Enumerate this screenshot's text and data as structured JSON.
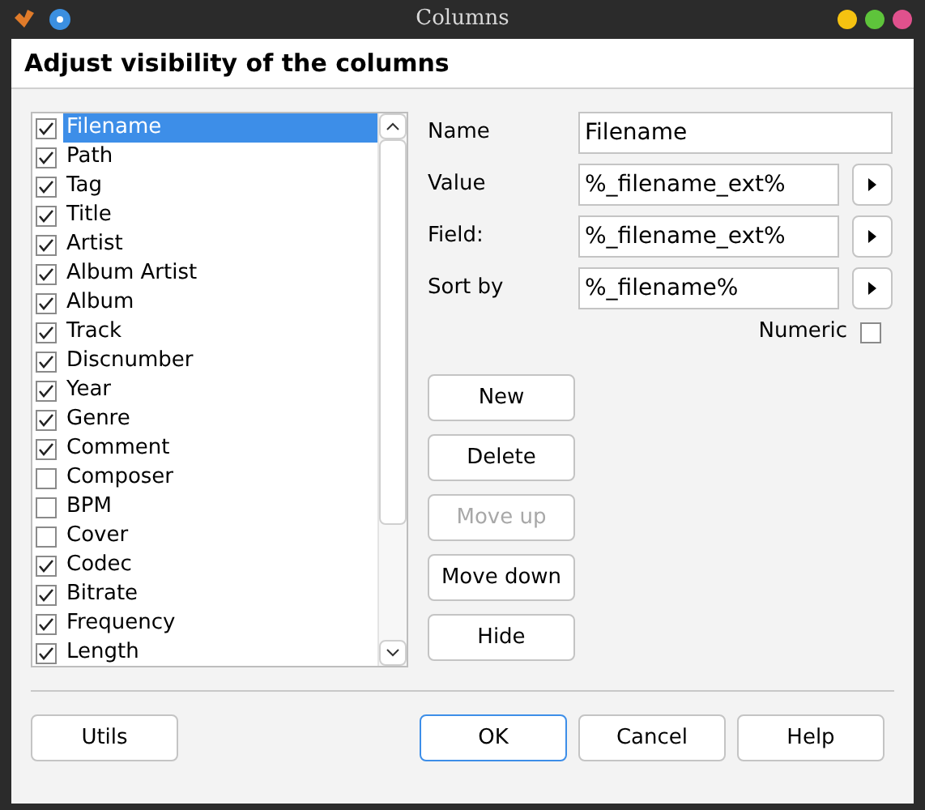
{
  "window": {
    "title": "Columns"
  },
  "header": "Adjust visibility of the columns",
  "columns": [
    {
      "label": "Filename",
      "checked": true,
      "selected": true
    },
    {
      "label": "Path",
      "checked": true,
      "selected": false
    },
    {
      "label": "Tag",
      "checked": true,
      "selected": false
    },
    {
      "label": "Title",
      "checked": true,
      "selected": false
    },
    {
      "label": "Artist",
      "checked": true,
      "selected": false
    },
    {
      "label": "Album Artist",
      "checked": true,
      "selected": false
    },
    {
      "label": "Album",
      "checked": true,
      "selected": false
    },
    {
      "label": "Track",
      "checked": true,
      "selected": false
    },
    {
      "label": "Discnumber",
      "checked": true,
      "selected": false
    },
    {
      "label": "Year",
      "checked": true,
      "selected": false
    },
    {
      "label": "Genre",
      "checked": true,
      "selected": false
    },
    {
      "label": "Comment",
      "checked": true,
      "selected": false
    },
    {
      "label": "Composer",
      "checked": false,
      "selected": false
    },
    {
      "label": "BPM",
      "checked": false,
      "selected": false
    },
    {
      "label": "Cover",
      "checked": false,
      "selected": false
    },
    {
      "label": "Codec",
      "checked": true,
      "selected": false
    },
    {
      "label": "Bitrate",
      "checked": true,
      "selected": false
    },
    {
      "label": "Frequency",
      "checked": true,
      "selected": false
    },
    {
      "label": "Length",
      "checked": true,
      "selected": false
    }
  ],
  "fields": [
    {
      "label": "Name",
      "value": "Filename",
      "has_menu": false
    },
    {
      "label": "Value",
      "value": "%_filename_ext%",
      "has_menu": true
    },
    {
      "label": "Field:",
      "value": "%_filename_ext%",
      "has_menu": true
    },
    {
      "label": "Sort by",
      "value": "%_filename%",
      "has_menu": true
    }
  ],
  "numeric": {
    "label": "Numeric",
    "checked": false
  },
  "actions": [
    {
      "label": "New",
      "disabled": false
    },
    {
      "label": "Delete",
      "disabled": false
    },
    {
      "label": "Move up",
      "disabled": true
    },
    {
      "label": "Move down",
      "disabled": false
    },
    {
      "label": "Hide",
      "disabled": false
    }
  ],
  "footer": {
    "left": "Utils",
    "buttons": [
      {
        "label": "OK",
        "default": true
      },
      {
        "label": "Cancel",
        "default": false
      },
      {
        "label": "Help",
        "default": false
      }
    ]
  }
}
